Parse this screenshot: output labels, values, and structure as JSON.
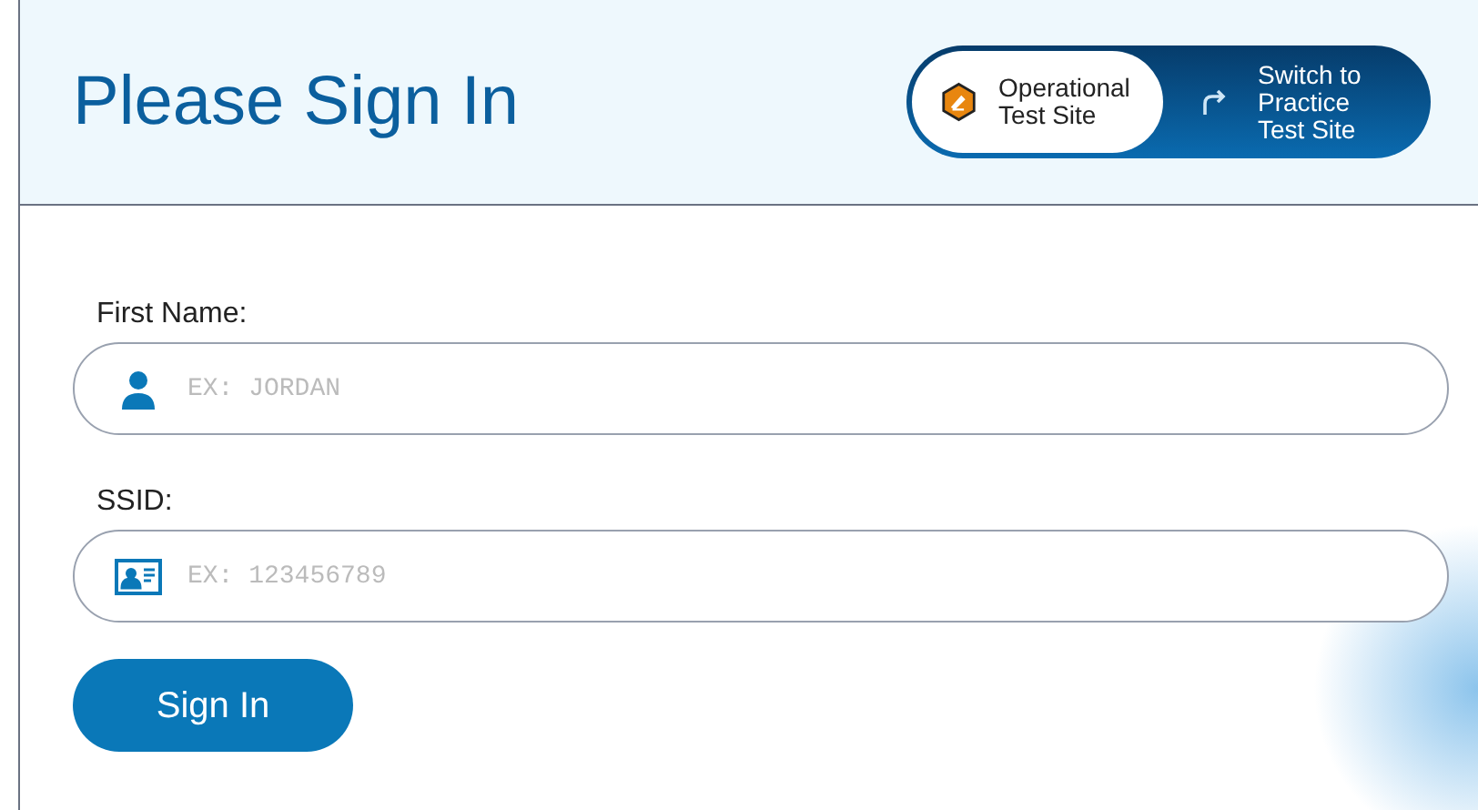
{
  "title": "Please Sign In",
  "site_switch": [
    {
      "label": "Operational Test Site",
      "selected": true
    },
    {
      "label": "Switch to Practice Test Site",
      "selected": false
    }
  ],
  "fields": [
    {
      "kind": "person",
      "label": "First Name:",
      "placeholder": "EX: JORDAN"
    },
    {
      "kind": "card",
      "label": "SSID:",
      "placeholder": "EX: 123456789"
    }
  ],
  "button": "Sign In"
}
